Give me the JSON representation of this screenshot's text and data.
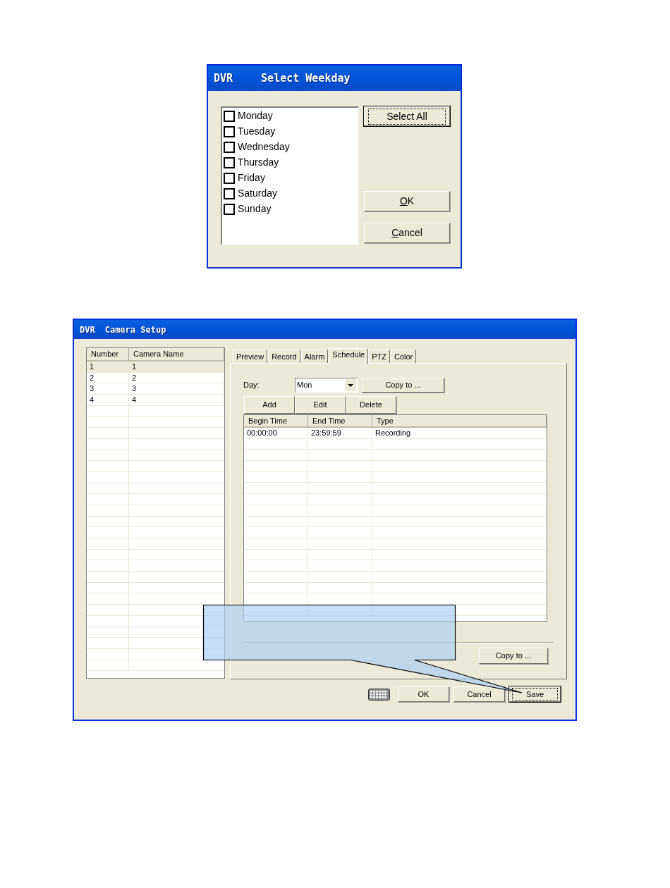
{
  "select_weekday_dialog": {
    "title_prefix": "DVR",
    "title": "Select Weekday",
    "days": [
      {
        "label": "Monday",
        "checked": false
      },
      {
        "label": "Tuesday",
        "checked": false
      },
      {
        "label": "Wednesday",
        "checked": false
      },
      {
        "label": "Thursday",
        "checked": false
      },
      {
        "label": "Friday",
        "checked": false
      },
      {
        "label": "Saturday",
        "checked": false
      },
      {
        "label": "Sunday",
        "checked": false
      }
    ],
    "select_all_button": {
      "label": "Select All",
      "focused": true,
      "mnemonic": false
    },
    "buttons": [
      {
        "label": "OK",
        "focused": false,
        "mnemonic": true
      },
      {
        "label": "Cancel",
        "focused": false,
        "mnemonic": true
      }
    ]
  },
  "camera_setup_dialog": {
    "title_prefix": "DVR",
    "title": "Camera Setup",
    "camera_table": {
      "columns": [
        "Number",
        "Camera Name"
      ],
      "rows": [
        {
          "cells": [
            "1",
            "1"
          ],
          "selected": true
        },
        {
          "cells": [
            "2",
            "2"
          ],
          "selected": false
        },
        {
          "cells": [
            "3",
            "3"
          ],
          "selected": false
        },
        {
          "cells": [
            "4",
            "4"
          ],
          "selected": false
        }
      ]
    },
    "tabs": [
      {
        "label": "Preview",
        "selected": false
      },
      {
        "label": "Record",
        "selected": false
      },
      {
        "label": "Alarm",
        "selected": false
      },
      {
        "label": "Schedule",
        "selected": true
      },
      {
        "label": "PTZ",
        "selected": false
      },
      {
        "label": "Color",
        "selected": false
      }
    ],
    "schedule": {
      "day_label": "Day:",
      "day_value": "Mon",
      "copy_button": "Copy to ...",
      "actions": [
        "Add",
        "Edit",
        "Delete"
      ],
      "table": {
        "columns": [
          "Begin Time",
          "End Time",
          "Type"
        ],
        "rows": [
          [
            "00:00:00",
            "23:59:59",
            "Recording"
          ]
        ]
      },
      "bottom_copy_button": "Copy to ..."
    },
    "footer_buttons": [
      {
        "label": "OK",
        "focused": false
      },
      {
        "label": "Cancel",
        "focused": false
      },
      {
        "label": "Save",
        "focused": true
      }
    ]
  }
}
